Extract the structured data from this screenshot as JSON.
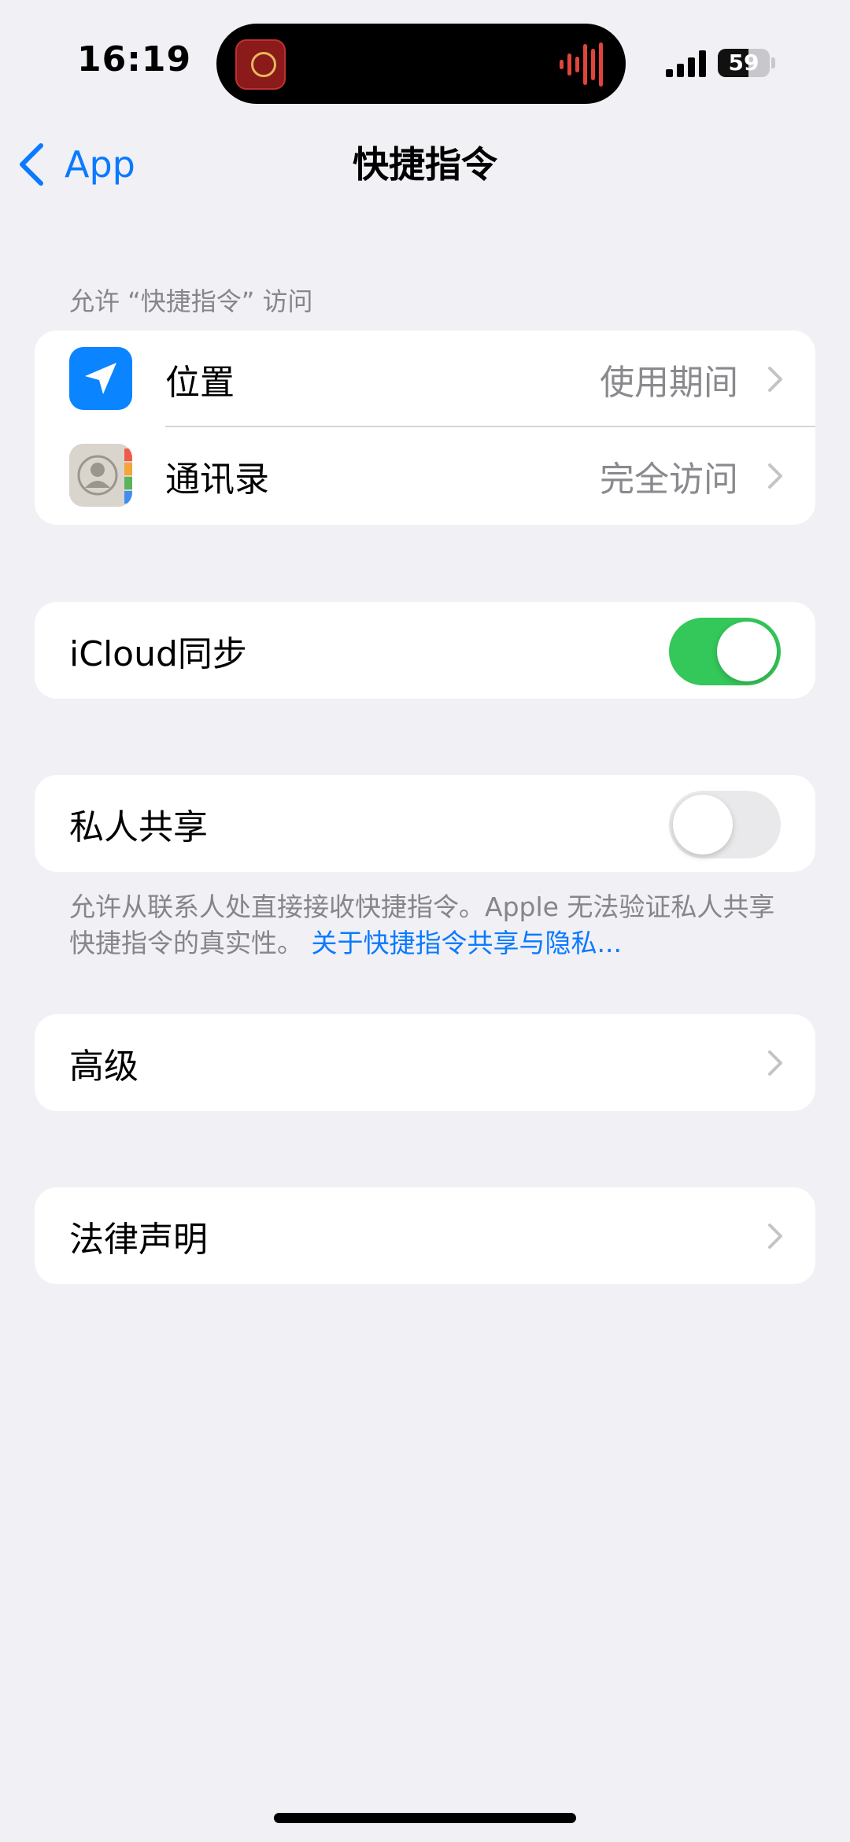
{
  "status_bar": {
    "time": "16:19",
    "battery_level": "59",
    "battery_fraction": 0.59,
    "icons": [
      "signal-icon",
      "battery-icon",
      "recording-waveform-icon"
    ]
  },
  "nav": {
    "back_label": "App",
    "title": "快捷指令"
  },
  "permissions_section": {
    "header": "允许 “快捷指令” 访问",
    "rows": [
      {
        "label": "位置",
        "value": "使用期间",
        "icon": "location-arrow-icon"
      },
      {
        "label": "通讯录",
        "value": "完全访问",
        "icon": "contacts-icon"
      }
    ]
  },
  "icloud_sync": {
    "label": "iCloud同步",
    "enabled": true
  },
  "private_sharing": {
    "label": "私人共享",
    "enabled": false,
    "footer_text": "允许从联系人处直接接收快捷指令。Apple 无法验证私人共享快捷指令的真实性。 ",
    "footer_link": "关于快捷指令共享与隐私..."
  },
  "advanced": {
    "label": "高级"
  },
  "legal": {
    "label": "法律声明"
  },
  "colors": {
    "accent": "#0a7aff",
    "toggle_on": "#34c759",
    "background": "#f0f0f5"
  }
}
